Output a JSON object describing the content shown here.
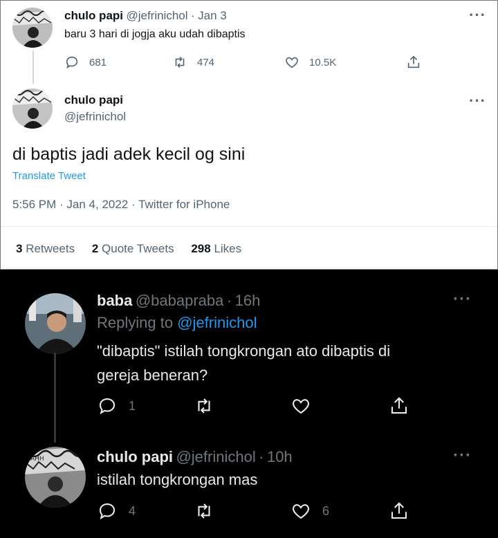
{
  "top_tweet": {
    "display_name": "chulo papi",
    "handle": "@jefrinichol",
    "sep": "·",
    "date": "Jan 3",
    "text": "baru 3 hari di jogja aku  udah dibaptis",
    "replies": "681",
    "retweets": "474",
    "likes": "10.5K",
    "icons": [
      "reply-icon",
      "retweet-icon",
      "like-icon",
      "share-icon",
      "more-icon"
    ]
  },
  "main_tweet": {
    "display_name": "chulo papi",
    "handle": "@jefrinichol",
    "text": "di baptis jadi adek kecil og sini",
    "translate": "Translate Tweet",
    "timestamp": "5:56 PM · Jan 4, 2022 · Twitter for iPhone",
    "stats": {
      "retweets_count": "3",
      "retweets_label": "Retweets",
      "quotes_count": "2",
      "quotes_label": "Quote Tweets",
      "likes_count": "298",
      "likes_label": "Likes"
    }
  },
  "reply1": {
    "display_name": "baba",
    "handle": "@babapraba",
    "sep": "·",
    "time": "16h",
    "replying_prefix": "Replying to ",
    "replying_to": "@jefrinichol",
    "text_line1": "\"dibaptis\" istilah tongkrongan ato dibaptis di",
    "text_line2": "gereja beneran?",
    "replies": "1",
    "retweets": "",
    "likes": ""
  },
  "reply2": {
    "display_name": "chulo papi",
    "handle": "@jefrinichol",
    "sep": "·",
    "time": "10h",
    "text": "istilah tongkrongan mas",
    "replies": "4",
    "retweets": "",
    "likes": "6"
  },
  "colors": {
    "light_bg": "#ffffff",
    "dark_bg": "#000000",
    "link_blue": "#1d9bf0",
    "muted_light": "#536471",
    "muted_dark": "#71767b"
  }
}
